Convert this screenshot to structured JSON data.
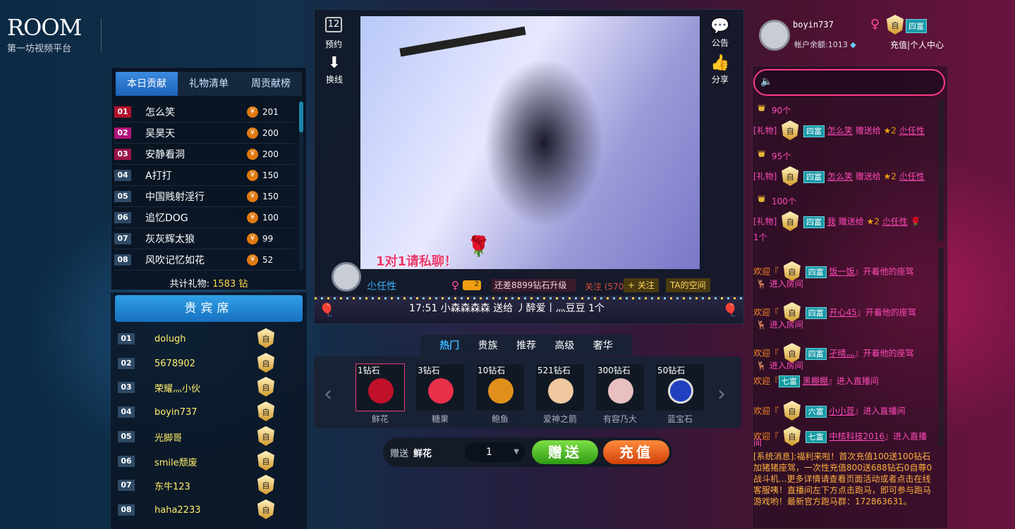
{
  "logo": {
    "title": "ROOM",
    "subtitle": "第一坊视频平台"
  },
  "left": {
    "tabs": [
      "本日贡献",
      "礼物清单",
      "周贡献榜"
    ],
    "ranking": [
      {
        "num": "01",
        "name": "怎么笑",
        "value": "201"
      },
      {
        "num": "02",
        "name": "吴昊天",
        "value": "200"
      },
      {
        "num": "03",
        "name": "安静看洞",
        "value": "200"
      },
      {
        "num": "04",
        "name": "A打打",
        "value": "150"
      },
      {
        "num": "05",
        "name": "中国贱射淫行",
        "value": "150"
      },
      {
        "num": "06",
        "name": "追忆DOG",
        "value": "100"
      },
      {
        "num": "07",
        "name": "灰灰辉太狼",
        "value": "99"
      },
      {
        "num": "08",
        "name": "风吹记忆如花",
        "value": "52"
      }
    ],
    "coin": "￥",
    "total_label": "共计礼物:",
    "total_value": "1583",
    "total_unit": "钻"
  },
  "guests": {
    "title": "贵宾席",
    "badge": "自",
    "list": [
      {
        "num": "01",
        "name": "dolugh"
      },
      {
        "num": "02",
        "name": "5678902"
      },
      {
        "num": "03",
        "name": "荣耀灬小伙"
      },
      {
        "num": "04",
        "name": "boyin737"
      },
      {
        "num": "05",
        "name": "光脚哥"
      },
      {
        "num": "06",
        "name": "smile颓废"
      },
      {
        "num": "07",
        "name": "东牛123"
      },
      {
        "num": "08",
        "name": "haha2233"
      }
    ]
  },
  "stage": {
    "tool_left": [
      {
        "icon": "12",
        "label": "预约"
      },
      {
        "icon": "⬇",
        "label": "换线"
      }
    ],
    "tool_right": [
      {
        "icon": "💬",
        "label": "公告"
      },
      {
        "icon": "👍",
        "label": "分享"
      }
    ],
    "promo": "1对1请私聊！",
    "anchor_name": "尐任性",
    "level": "2",
    "upgrade": "还差8899钻石升级",
    "follow_count": "关注 (570)",
    "follow_btn": "+ 关注",
    "space_btn": "TA的空间",
    "ticker": "17:51  小森森森森 送给 丿醉爱丨灬豆豆   1个"
  },
  "gifts": {
    "tabs": [
      "热门",
      "贵族",
      "推荐",
      "高级",
      "奢华"
    ],
    "items": [
      {
        "price": "1钻石",
        "name": "鲜花",
        "color": "#c0102a"
      },
      {
        "price": "3钻石",
        "name": "糖果",
        "color": "#e8304a"
      },
      {
        "price": "10钻石",
        "name": "鲍鱼",
        "color": "#e0901a"
      },
      {
        "price": "521钻石",
        "name": "爱神之箭",
        "color": "#f0c8a0"
      },
      {
        "price": "300钻石",
        "name": "有容乃大",
        "color": "#e8c0c0"
      },
      {
        "price": "50钻石",
        "name": "蓝宝石",
        "color": "#2040c0"
      }
    ],
    "send_label": "赠送",
    "send_gift": "鲜花",
    "qty": "1",
    "send_btn": "赠送",
    "charge_btn": "充值"
  },
  "user": {
    "name": "boyin737",
    "balance": "帐户余额:1013",
    "rich": "四富",
    "links": "充值|个人中心"
  },
  "chat_gifts": [
    {
      "count": "90个",
      "name": "怎么笑",
      "action": "赠送给",
      "to": "尐任性"
    },
    {
      "count": "95个",
      "name": "怎么笑",
      "action": "赠送给",
      "to": "尐任性"
    },
    {
      "count": "100个",
      "name": "我",
      "action": "赠送给",
      "to": "尐任性",
      "tail": "1个"
    }
  ],
  "chat_tag": "[礼物]",
  "chat_welcome": [
    {
      "prefix": "欢迎『",
      "rich": "四富",
      "name": "饭一饭",
      "text": "』开着他的座驾",
      "text2": "进入房间"
    },
    {
      "prefix": "欢迎『",
      "rich": "四富",
      "name": "开心45",
      "text": "』开着他的座驾",
      "text2": "进入房间"
    },
    {
      "prefix": "欢迎『",
      "rich": "四富",
      "name": "孑晴灬",
      "text": "』开着他的座驾",
      "text2": "进入房间"
    },
    {
      "prefix": "欢迎『",
      "rich": "七富",
      "name": "黑棚棚",
      "text": "』进入直播间"
    },
    {
      "prefix": "欢迎『",
      "rich": "六富",
      "name": "小小荳",
      "text": "』进入直播间"
    },
    {
      "prefix": "欢迎『",
      "rich": "七富",
      "name": "中核科技2016",
      "text": "』进入直播",
      "text2": "间"
    }
  ],
  "system_msg": "[系统消息]:福利来啦！首次充值100送100钻石加猪猪座驾，一次性充值800送688钻石0自尊0战斗机...更多详情请查看页面活动或者点击在线客服咦！直播间左下方点击跑马，即可参与跑马游戏哟！最新官方跑马群：172863631。"
}
